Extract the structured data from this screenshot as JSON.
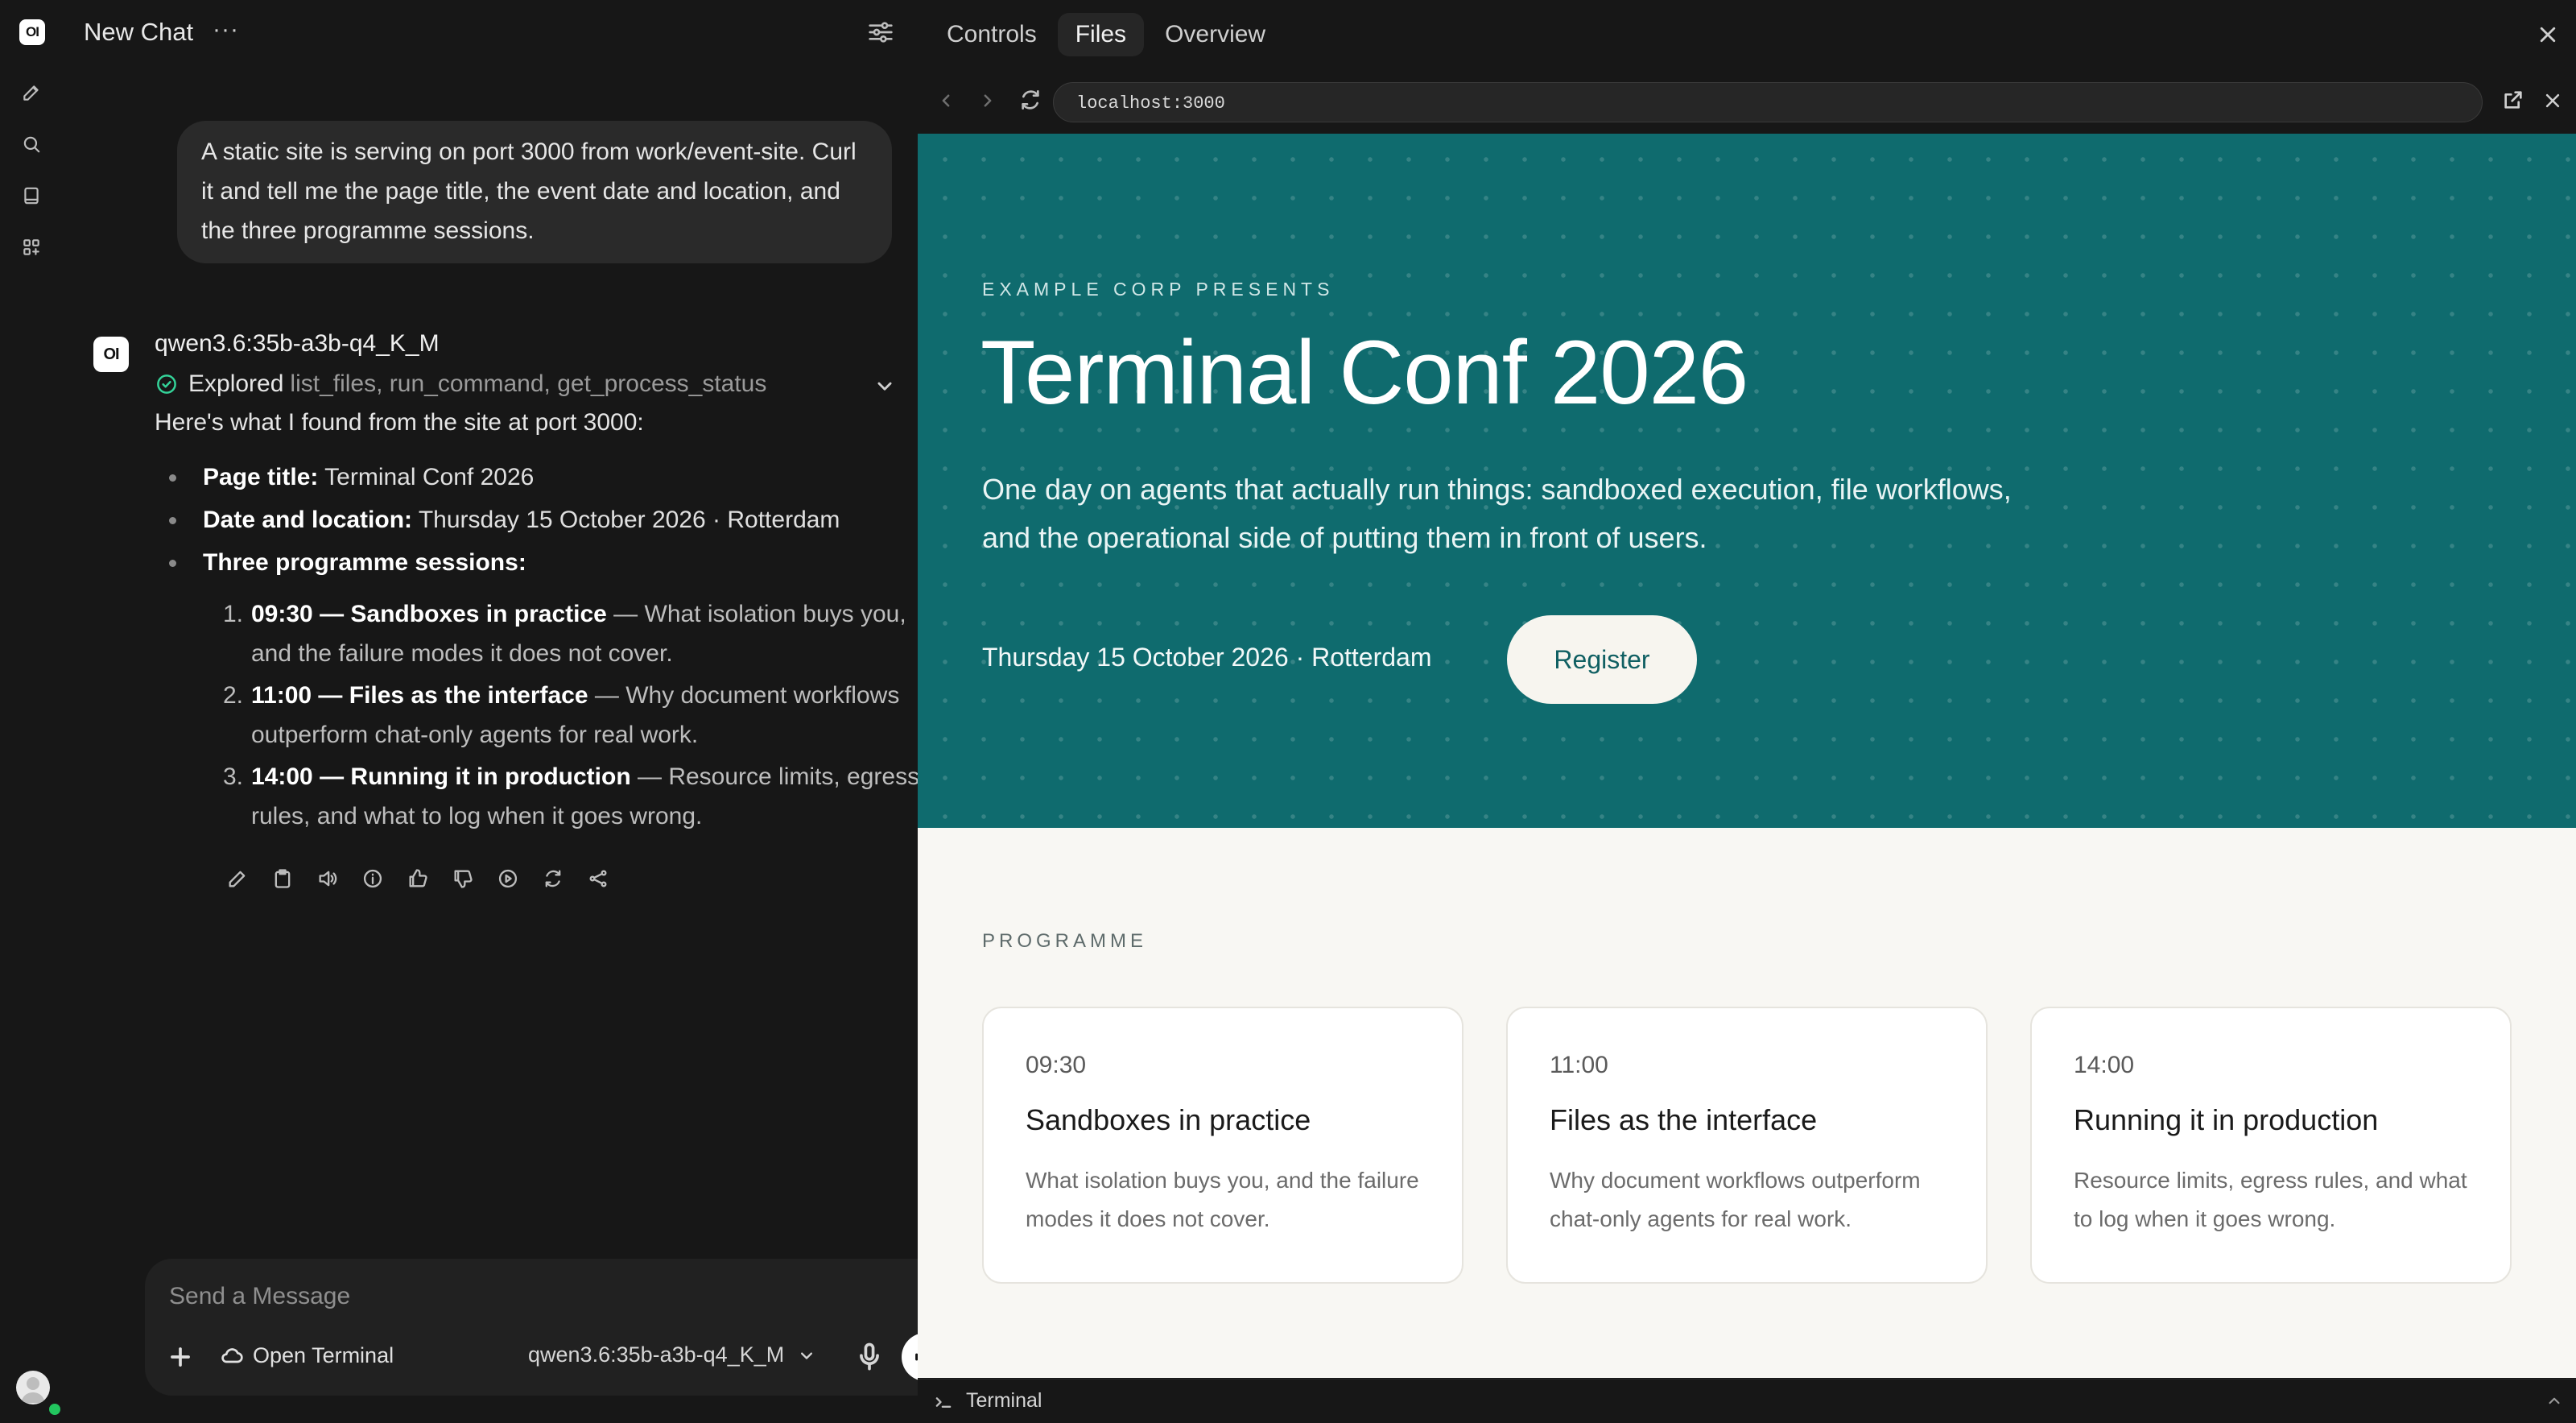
{
  "app": {
    "logo_text": "OI",
    "chat_title": "New Chat"
  },
  "chat": {
    "user_message": "A static site is serving on port 3000 from work/event-site. Curl it and tell me the page title, the event date and location, and the three programme sessions.",
    "assistant": {
      "avatar_text": "OI",
      "model": "qwen3.6:35b-a3b-q4_K_M",
      "explored_label": "Explored",
      "explored_tools": "list_files, run_command, get_process_status",
      "intro": "Here's what I found from the site at port 3000:",
      "bullets": [
        {
          "label": "Page title:",
          "value": "Terminal Conf 2026"
        },
        {
          "label": "Date and location:",
          "value": "Thursday 15 October 2026 · Rotterdam"
        },
        {
          "label": "Three programme sessions:",
          "value": ""
        }
      ],
      "sessions": [
        {
          "num": "1.",
          "head": "09:30 — Sandboxes in practice",
          "rest": " — What isolation buys you, and the failure modes it does not cover."
        },
        {
          "num": "2.",
          "head": "11:00 — Files as the interface",
          "rest": " — Why document workflows outperform chat-only agents for real work."
        },
        {
          "num": "3.",
          "head": "14:00 — Running it in production",
          "rest": " — Resource limits, egress rules, and what to log when it goes wrong."
        }
      ]
    },
    "composer": {
      "placeholder": "Send a Message",
      "open_terminal_label": "Open Terminal",
      "model_select": "qwen3.6:35b-a3b-q4_K_M"
    }
  },
  "panel": {
    "tabs": [
      "Controls",
      "Files",
      "Overview"
    ],
    "active_tab": "Files",
    "url": "localhost:3000",
    "terminal_label": "Terminal"
  },
  "site": {
    "eyebrow": "EXAMPLE CORP PRESENTS",
    "title": "Terminal Conf 2026",
    "description": "One day on agents that actually run things: sandboxed execution, file workflows, and the operational side of putting them in front of users.",
    "date_location": "Thursday 15 October 2026 · Rotterdam",
    "register_label": "Register",
    "programme_label": "PROGRAMME",
    "cards": [
      {
        "time": "09:30",
        "title": "Sandboxes in practice",
        "desc": "What isolation buys you, and the failure modes it does not cover."
      },
      {
        "time": "11:00",
        "title": "Files as the interface",
        "desc": "Why document workflows outperform chat-only agents for real work."
      },
      {
        "time": "14:00",
        "title": "Running it in production",
        "desc": "Resource limits, egress rules, and what to log when it goes wrong."
      }
    ],
    "colors": {
      "hero": "#0f6b6e",
      "accent_text": "#0f5f62",
      "programme_bg": "#f8f7f3"
    }
  }
}
